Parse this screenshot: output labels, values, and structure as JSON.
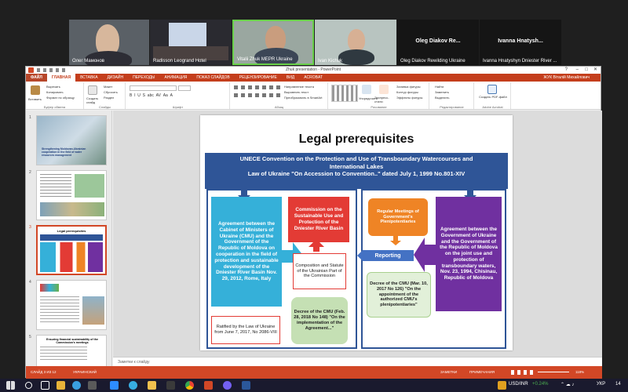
{
  "video_tiles": [
    {
      "name": "Олег Мамонов"
    },
    {
      "name": "Radisson Leogrand Hotel"
    },
    {
      "name": "Vitalii Zhuk MEPR Ukraine"
    },
    {
      "name": "Ivan Kichuk"
    },
    {
      "name": "Oleg Diakov Rewilding Ukraine",
      "big": "Oleg  Diakov  Re..."
    },
    {
      "name": "Ivanna Hnatyshyn Dniester River ...",
      "big": "Ivanna  Hnatysh..."
    }
  ],
  "window": {
    "title": "Zhuk presentation - PowerPoint",
    "user": "ЖУК Віталій Михайлович",
    "tabs": [
      "ФАЙЛ",
      "ГЛАВНАЯ",
      "ВСТАВКА",
      "ДИЗАЙН",
      "ПЕРЕХОДЫ",
      "АНИМАЦИЯ",
      "ПОКАЗ СЛАЙДОВ",
      "РЕЦЕНЗИРОВАНИЕ",
      "ВИД",
      "ACROBAT"
    ],
    "active_tab": "ГЛАВНАЯ"
  },
  "ribbon": {
    "paste": "Вставить",
    "cut": "Вырезать",
    "copy": "Копировать",
    "format_painter": "Формат по образцу",
    "group_clipboard": "Буфер обмена",
    "new_slide": "Создать слайд",
    "layout": "Макет",
    "reset": "Сбросить",
    "section": "Раздел",
    "group_slides": "Слайды",
    "group_font": "Шрифт",
    "text_direction": "Направление текста",
    "align_text": "Выровнять текст",
    "convert_smartart": "Преобразовать в SmartArt",
    "group_paragraph": "Абзац",
    "arrange": "Упорядочить",
    "quick_styles": "Экспресс-стили",
    "shape_fill": "Заливка фигуры",
    "shape_outline": "Контур фигуры",
    "shape_effects": "Эффекты фигуры",
    "group_drawing": "Рисование",
    "find": "Найти",
    "replace": "Заменить",
    "select": "Выделить",
    "group_editing": "Редактирование",
    "create_pdf": "Создать PDF-файл",
    "group_acrobat": "Adobe Acrobat"
  },
  "thumbnails": [
    {
      "num": "1",
      "text": "Strengthening Moldovan-Ukrainian cooperation in the field of water resources management"
    },
    {
      "num": "2"
    },
    {
      "num": "3",
      "text": "Legal prerequisites"
    },
    {
      "num": "4"
    },
    {
      "num": "5",
      "text": "Ensuring financial sustainability of the Commission's meetings"
    }
  ],
  "slide": {
    "title": "Legal prerequisites",
    "header": [
      "UNECE Convention on the Protection and Use of Transboundary Watercourses and",
      "International Lakes",
      "Law of Ukraine \"On Accession to Convention..\" dated July 1, 1999 No.801-XIV"
    ],
    "agreement_cmu": "Agreement between the Cabinet of Ministers of Ukraine (CMU) and the Government of the Republic of Moldova on cooperation in the field of protection and sustainable development of the Dniester River Basin Nov. 29, 2012,  Rome, Italy",
    "ratified": "Ratified by the Law of Ukraine from June 7, 2017, No 2086-VIII",
    "commission": "Commission on the Sustainable Use and Protection of the Dniester River Basin",
    "composition": "Composition and Statute of the Ukrainian Part of the Commission",
    "decree1": "Decree of the CMU (Feb. 28, 2018 No 148)  \"On the implementation of the Agreement...\"",
    "reporting": "Reporting",
    "meetings": "Regular Meetings of Government's Plenipotentiaries",
    "decree2": "Decree of the CMU (Mar. 10, 2017 No 126)   \"On the appointment of the authorized CMU's plenipotentiaries\"",
    "agreement_gov": "Agreement between the Government of Ukraine and the Government of the Republic of Moldova on the joint use and protection of transboundary waters, Nov. 23, 1994, Chisinau, Republic of Moldova"
  },
  "notes_placeholder": "Заметки к слайду",
  "status": {
    "slide": "СЛАЙД 3 ИЗ 12",
    "lang": "УКРАИНСКИЙ",
    "notes": "ЗАМЕТКИ",
    "comments": "ПРИМЕЧАНИЯ",
    "zoom": "118%"
  },
  "taskbar": {
    "ticker": "USD/INR",
    "change": "+0.24%",
    "lang": "УКР",
    "time": "14"
  },
  "colors": {
    "accent": "#d24726",
    "navy": "#2f5597",
    "cyan": "#35b0d9",
    "red": "#e33b35",
    "orange": "#ef8425",
    "purple": "#7030a0",
    "green": "#c5e0b4"
  }
}
